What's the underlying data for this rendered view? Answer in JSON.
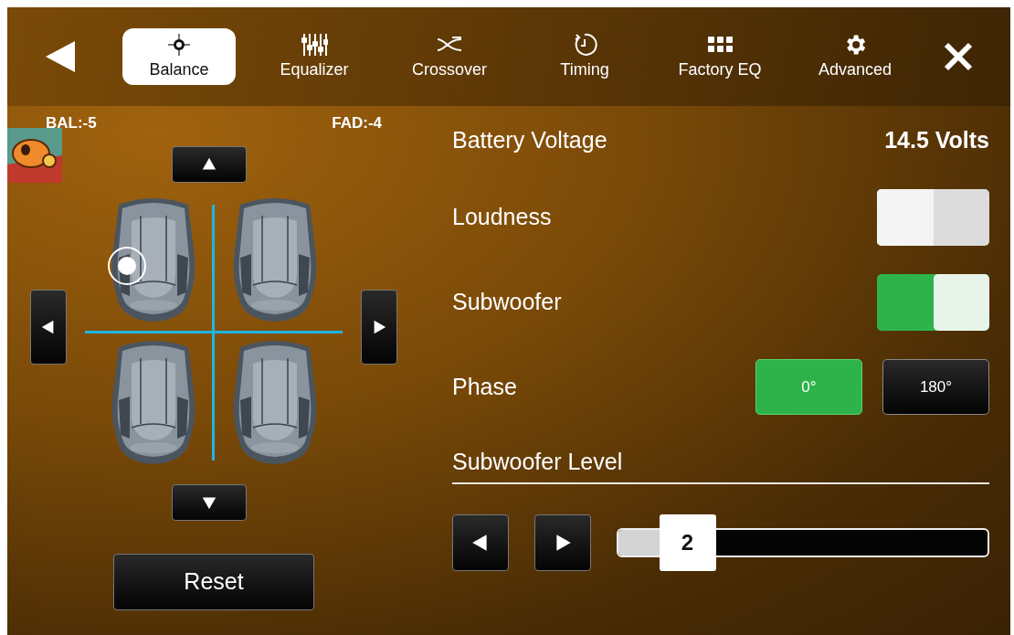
{
  "toolbar": {
    "tabs": [
      {
        "label": "Balance",
        "selected": true
      },
      {
        "label": "Equalizer",
        "selected": false
      },
      {
        "label": "Crossover",
        "selected": false
      },
      {
        "label": "Timing",
        "selected": false
      },
      {
        "label": "Factory EQ",
        "selected": false
      },
      {
        "label": "Advanced",
        "selected": false
      }
    ]
  },
  "balance": {
    "bal": "BAL:-5",
    "fad": "FAD:-4",
    "reset": "Reset"
  },
  "settings": [
    {
      "kind": "reading",
      "label": "Battery Voltage",
      "value": "14.5 Volts"
    },
    {
      "kind": "toggle",
      "label": "Loudness",
      "on": false
    },
    {
      "kind": "toggle",
      "label": "Subwoofer",
      "on": true
    },
    {
      "kind": "choice",
      "label": "Phase",
      "options": [
        {
          "label": "0°",
          "selected": true
        },
        {
          "label": "180°",
          "selected": false
        }
      ]
    }
  ],
  "subwoofer_level": {
    "label": "Subwoofer Level",
    "level": 0.19,
    "reading": "2"
  }
}
